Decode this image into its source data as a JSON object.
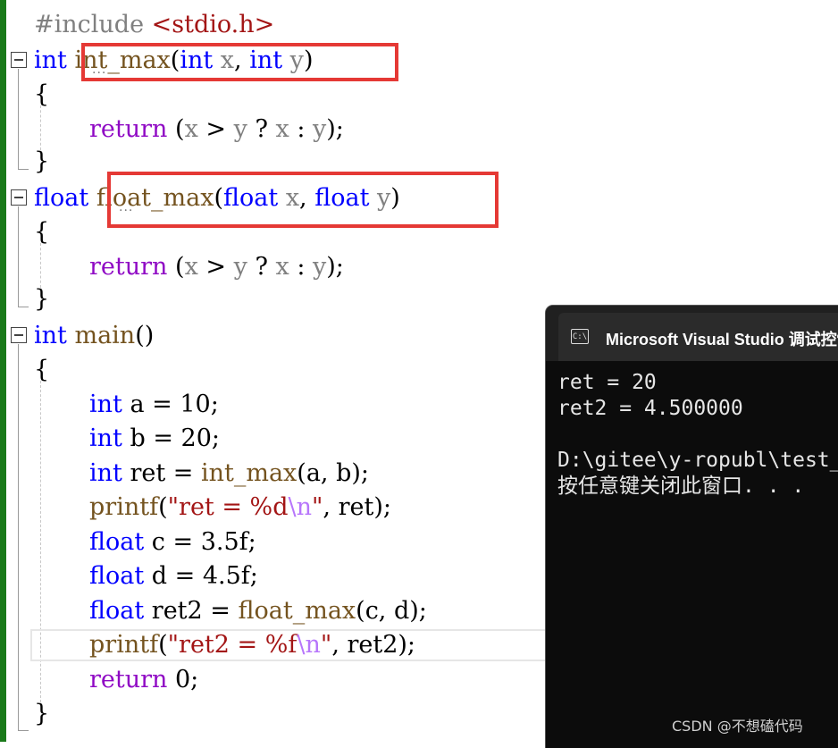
{
  "editor": {
    "line1_include": "#include",
    "line1_header": "<stdio.h>",
    "l2_type": "int",
    "l2_fn": "int_max",
    "l2_open": "(",
    "l2_p1type": "int",
    "l2_p1": "x",
    "l2_comma": ", ",
    "l2_p2type": "int",
    "l2_p2": "y",
    "l2_close": ")",
    "brace_open": "{",
    "brace_close": "}",
    "return_kw": "return",
    "ret_expr_open": "(",
    "ret_x": "x",
    "ret_gt": " > ",
    "ret_y": "y",
    "ret_q": " ? ",
    "ret_x2": "x",
    "ret_colon": " : ",
    "ret_y2": "y",
    "ret_end": ");",
    "l6_type": "float",
    "l6_fn": "float_max",
    "l6_p1type": "float",
    "l6_p2type": "float",
    "l11_type": "int",
    "l11_fn": "main",
    "l11_parens": "()",
    "l13_type": "int",
    "l13_rest": " a = 10;",
    "l14_type": "int",
    "l14_rest": " b = 20;",
    "l15_type": "int",
    "l15_mid": " ret = ",
    "l15_fn": "int_max",
    "l15_args": "(a, b);",
    "l16_fn": "printf",
    "l16_q1": "\"",
    "l16_str": "ret = %d",
    "l16_esc": "\\n",
    "l16_q2": "\"",
    "l16_rest": ", ret);",
    "l17_type": "float",
    "l17_rest": " c = 3.5f;",
    "l18_type": "float",
    "l18_rest": " d = 4.5f;",
    "l19_type": "float",
    "l19_mid": " ret2 = ",
    "l19_fn": "float_max",
    "l19_args": "(c, d);",
    "l20_fn": "printf",
    "l20_str": "ret2 = %f",
    "l20_rest": ", ret2);",
    "l21_rest": " 0;",
    "ellipsis": "..."
  },
  "console": {
    "title": "Microsoft Visual Studio 调试控制台",
    "icon_label": "C:\\",
    "output_lines": [
      "ret = 20",
      "ret2 = 4.500000",
      "",
      "D:\\gitee\\y-ropubl\\test_",
      "按任意键关闭此窗口. . ."
    ]
  },
  "watermark": "CSDN @不想磕代码",
  "colors": {
    "keyword": "#0000ff",
    "return_keyword": "#8f08c4",
    "function": "#74531f",
    "parameter": "#808080",
    "string": "#a31515",
    "escape": "#b776fb",
    "highlight_box": "#e53935",
    "console_bg": "#0c0c0c"
  }
}
